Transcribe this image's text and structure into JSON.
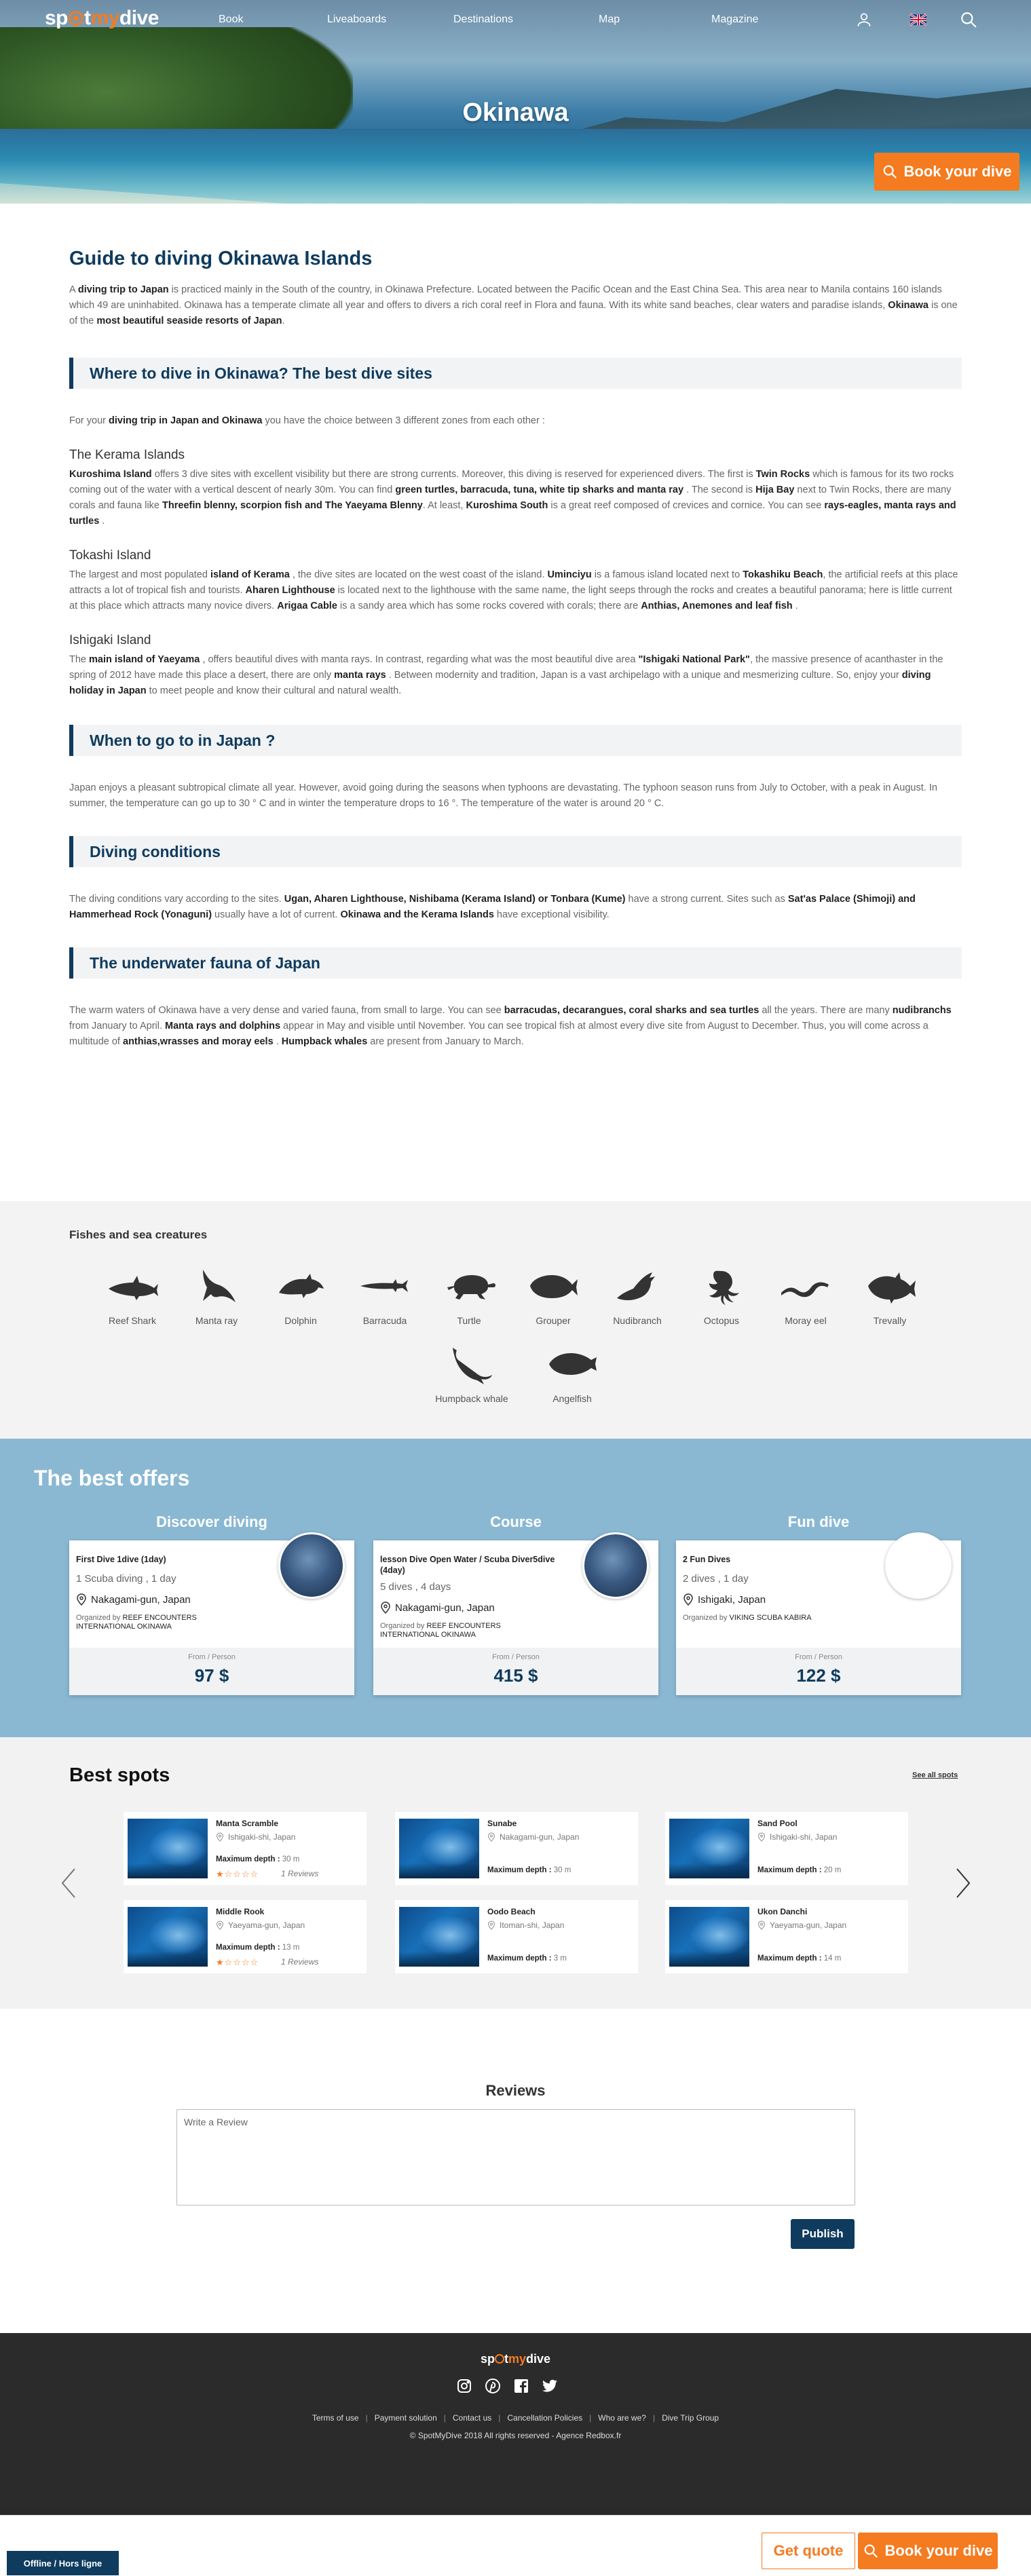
{
  "nav": {
    "logo": "spotmydive",
    "links": [
      "Book",
      "Liveaboards",
      "Destinations",
      "Map",
      "Magazine"
    ]
  },
  "hero": {
    "title": "Okinawa",
    "book_button": "Book your dive"
  },
  "guide": {
    "title": "Guide to diving Okinawa Islands",
    "intro": "A <b>diving trip to Japan</b> is practiced mainly in the South of the country, in Okinawa Prefecture. Located between the Pacific Ocean and the East China Sea. This area near to Manila contains 160 islands which 49 are uninhabited. Okinawa has a temperate climate all year and offers to divers a rich coral reef in Flora and fauna. With its white sand beaches, clear waters and paradise islands, <b>Okinawa</b> is one of the <b>most beautiful seaside resorts of Japan</b>."
  },
  "sections": {
    "where_title": "Where to dive in Okinawa? The best dive sites",
    "where_intro": "For your <b>diving trip in Japan and Okinawa</b> you have the choice between 3 different zones from each other :",
    "kerama_title": "The Kerama Islands",
    "kerama_text": "<b>Kuroshima Island</b> offers 3 dive sites with excellent visibility but there are strong currents. Moreover, this diving is reserved for experienced divers. The first is <b>Twin Rocks</b> which is famous for its two rocks coming out of the water with a vertical descent of nearly 30m. You can find <b>green turtles, barracuda, tuna, white tip sharks and manta ray</b> . The second is <b>Hija Bay</b> next to Twin Rocks, there are many corals and fauna like <b>Threefin blenny, scorpion fish and The Yaeyama Blenny</b>. At least, <b>Kuroshima South</b> is a great reef composed of crevices and cornice. You can see <b>rays-eagles, manta rays and turtles</b> .",
    "tokashi_title": "Tokashi Island",
    "tokashi_text": "The largest and most populated <b>island of Kerama</b> , the dive sites are located on the west coast of the island. <b>Uminciyu</b> is a famous island located next to <b>Tokashiku Beach</b>, the artificial reefs at this place attracts a lot of tropical fish and tourists. <b>Aharen Lighthouse</b> is located next to the lighthouse with the same name, the light seeps through the rocks and creates a beautiful panorama; here is little current at this place which attracts many novice divers. <b>Arigaa Cable</b> is a sandy area which has some rocks covered with corals; there are <b>Anthias, Anemones and leaf fish</b> .",
    "ishigaki_title": "Ishigaki Island",
    "ishigaki_text": "The <b>main island of Yaeyama</b> , offers beautiful dives with manta rays. In contrast, regarding what was the most beautiful dive area <b>\"Ishigaki National Park\"</b>, the massive presence of acanthaster in the spring of 2012 have made this place a desert, there are only <b>manta rays</b> . Between modernity and tradition, Japan is a vast archipelago with a unique and mesmerizing culture. So, enjoy your <b>diving holiday in Japan</b> to meet people and know their cultural and natural wealth.",
    "when_title": "When to go to in Japan ?",
    "when_text": "Japan enjoys a pleasant subtropical climate all year. However, avoid going during the seasons when typhoons are devastating. The typhoon season runs from July to October, with a peak in August. In summer, the temperature can go up to 30 ° C and in winter the temperature drops to 16 °. The temperature of the water is around 20 ° C.",
    "cond_title": "Diving conditions",
    "cond_text": "The diving conditions vary according to the sites. <b>Ugan, Aharen Lighthouse, Nishibama (Kerama Island) or Tonbara (Kume)</b> have a strong current. Sites such as <b>Sat'as Palace (Shimoji) and Hammerhead Rock (Yonaguni)</b> usually have a lot of current. <b>Okinawa and the Kerama Islands</b> have exceptional visibility.",
    "fauna_title": "The underwater fauna of Japan",
    "fauna_text": "The warm waters of Okinawa have a very dense and varied fauna, from small to large. You can see <b>barracudas, decarangues, coral sharks and sea turtles</b> all the years. There are many <b>nudibranchs</b> from January to April. <b>Manta rays and dolphins</b> appear in May and visible until November. You can see tropical fish at almost every dive site from August to December. Thus, you will come across a multitude of <b>anthias,wrasses and moray eels</b> . <b>Humpback whales</b> are present from January to March."
  },
  "fishes": {
    "title": "Fishes and sea creatures",
    "items": [
      {
        "label": "Reef Shark",
        "icon": "shark-icon"
      },
      {
        "label": "Manta ray",
        "icon": "manta-ray-icon"
      },
      {
        "label": "Dolphin",
        "icon": "dolphin-icon"
      },
      {
        "label": "Barracuda",
        "icon": "barracuda-icon"
      },
      {
        "label": "Turtle",
        "icon": "turtle-icon"
      },
      {
        "label": "Grouper",
        "icon": "grouper-icon"
      },
      {
        "label": "Nudibranch",
        "icon": "nudibranch-icon"
      },
      {
        "label": "Octopus",
        "icon": "octopus-icon"
      },
      {
        "label": "Moray eel",
        "icon": "moray-eel-icon"
      },
      {
        "label": "Trevally",
        "icon": "trevally-icon"
      },
      {
        "label": "Humpback whale",
        "icon": "whale-icon"
      },
      {
        "label": "Angelfish",
        "icon": "angelfish-icon"
      }
    ]
  },
  "offers": {
    "title": "The best offers",
    "cards": [
      {
        "category": "Discover diving",
        "name": "First Dive 1dive (1day)",
        "meta": "1 Scuba diving , 1 day",
        "location": "Nakagami-gun, Japan",
        "org_prefix": "Organized by",
        "org": "REEF ENCOUNTERS INTERNATIONAL OKINAWA",
        "from": "From / Person",
        "price": "97 $"
      },
      {
        "category": "Course",
        "name": "lesson Dive Open Water / Scuba Diver5dive (4day)",
        "meta": "5 dives , 4 days",
        "location": "Nakagami-gun, Japan",
        "org_prefix": "Organized by",
        "org": "REEF ENCOUNTERS INTERNATIONAL OKINAWA",
        "from": "From / Person",
        "price": "415 $"
      },
      {
        "category": "Fun dive",
        "name": "2 Fun Dives",
        "meta": "2 dives , 1 day",
        "location": "Ishigaki, Japan",
        "org_prefix": "Organized by",
        "org": "VIKING SCUBA KABIRA",
        "from": "From / Person",
        "price": "122 $"
      }
    ]
  },
  "spots": {
    "title": "Best spots",
    "see_all": "See all spots",
    "depth_label": "Maximum depth :",
    "items": [
      {
        "name": "Manta Scramble",
        "location": "Ishigaki-shi, Japan",
        "depth": "30 m",
        "rating": 1,
        "reviews": "1 Reviews"
      },
      {
        "name": "Sunabe",
        "location": "Nakagami-gun, Japan",
        "depth": "30 m"
      },
      {
        "name": "Sand Pool",
        "location": "Ishigaki-shi, Japan",
        "depth": "20 m"
      },
      {
        "name": "Middle Rook",
        "location": "Yaeyama-gun, Japan",
        "depth": "13 m",
        "rating": 1,
        "reviews": "1 Reviews"
      },
      {
        "name": "Oodo Beach",
        "location": "Itoman-shi, Japan",
        "depth": "3 m"
      },
      {
        "name": "Ukon Danchi",
        "location": "Yaeyama-gun, Japan",
        "depth": "14 m"
      }
    ]
  },
  "reviews": {
    "title": "Reviews",
    "placeholder": "Write a Review",
    "publish": "Publish"
  },
  "footer": {
    "logo": "spotmydive",
    "links": [
      "Terms of use",
      "Payment solution",
      "Contact us",
      "Cancellation Policies",
      "Who are we?",
      "Dive Trip Group"
    ],
    "copyright": "© SpotMyDive 2018 All rights reserved - Agence Redbox.fr"
  },
  "bottom_bar": {
    "offline": "Offline / Hors ligne",
    "get_quote": "Get quote",
    "book": "Book your dive"
  },
  "colors": {
    "accent": "#f47b20",
    "navy": "#0e3b5e",
    "offers_bg": "#8ab8d3"
  }
}
